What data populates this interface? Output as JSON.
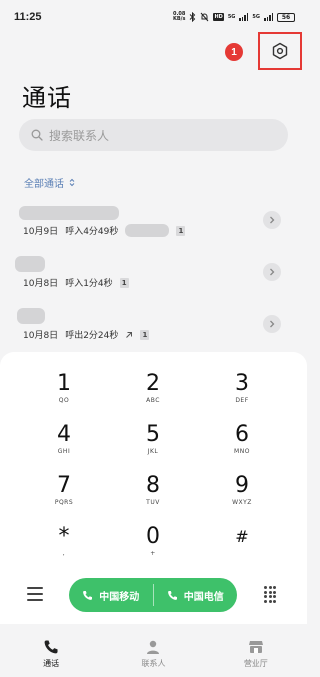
{
  "status_bar": {
    "time": "11:25",
    "network_speed_top": "0.08",
    "network_speed_bottom": "KB/s",
    "sim1": "5G",
    "sim2": "5G",
    "battery": "56"
  },
  "header": {
    "notification_count": "1",
    "title": "通话"
  },
  "search": {
    "placeholder": "搜索联系人"
  },
  "filter": {
    "label": "全部通话"
  },
  "calls": [
    {
      "date": "10月9日",
      "detail": "呼入4分49秒",
      "sim": "1",
      "direction": "incoming"
    },
    {
      "date": "10月8日",
      "detail": "呼入1分4秒",
      "sim": "1",
      "direction": "incoming"
    },
    {
      "date": "10月8日",
      "detail": "呼出2分24秒",
      "sim": "1",
      "direction": "outgoing"
    }
  ],
  "keypad": [
    {
      "num": "1",
      "letters": "QO"
    },
    {
      "num": "2",
      "letters": "ABC"
    },
    {
      "num": "3",
      "letters": "DEF"
    },
    {
      "num": "4",
      "letters": "GHI"
    },
    {
      "num": "5",
      "letters": "JKL"
    },
    {
      "num": "6",
      "letters": "MNO"
    },
    {
      "num": "7",
      "letters": "PQRS"
    },
    {
      "num": "8",
      "letters": "TUV"
    },
    {
      "num": "9",
      "letters": "WXYZ"
    },
    {
      "num": "*",
      "letters": ","
    },
    {
      "num": "0",
      "letters": "+"
    },
    {
      "num": "#",
      "letters": ""
    }
  ],
  "actions": {
    "call_sim1": "中国移动",
    "call_sim2": "中国电信"
  },
  "tabs": [
    {
      "label": "通话",
      "icon": "phone-icon",
      "active": true
    },
    {
      "label": "联系人",
      "icon": "contacts-icon",
      "active": false
    },
    {
      "label": "营业厅",
      "icon": "store-icon",
      "active": false
    }
  ],
  "colors": {
    "accent_green": "#3ec16a",
    "badge_red": "#e53935",
    "link_blue": "#5a7fb5"
  }
}
